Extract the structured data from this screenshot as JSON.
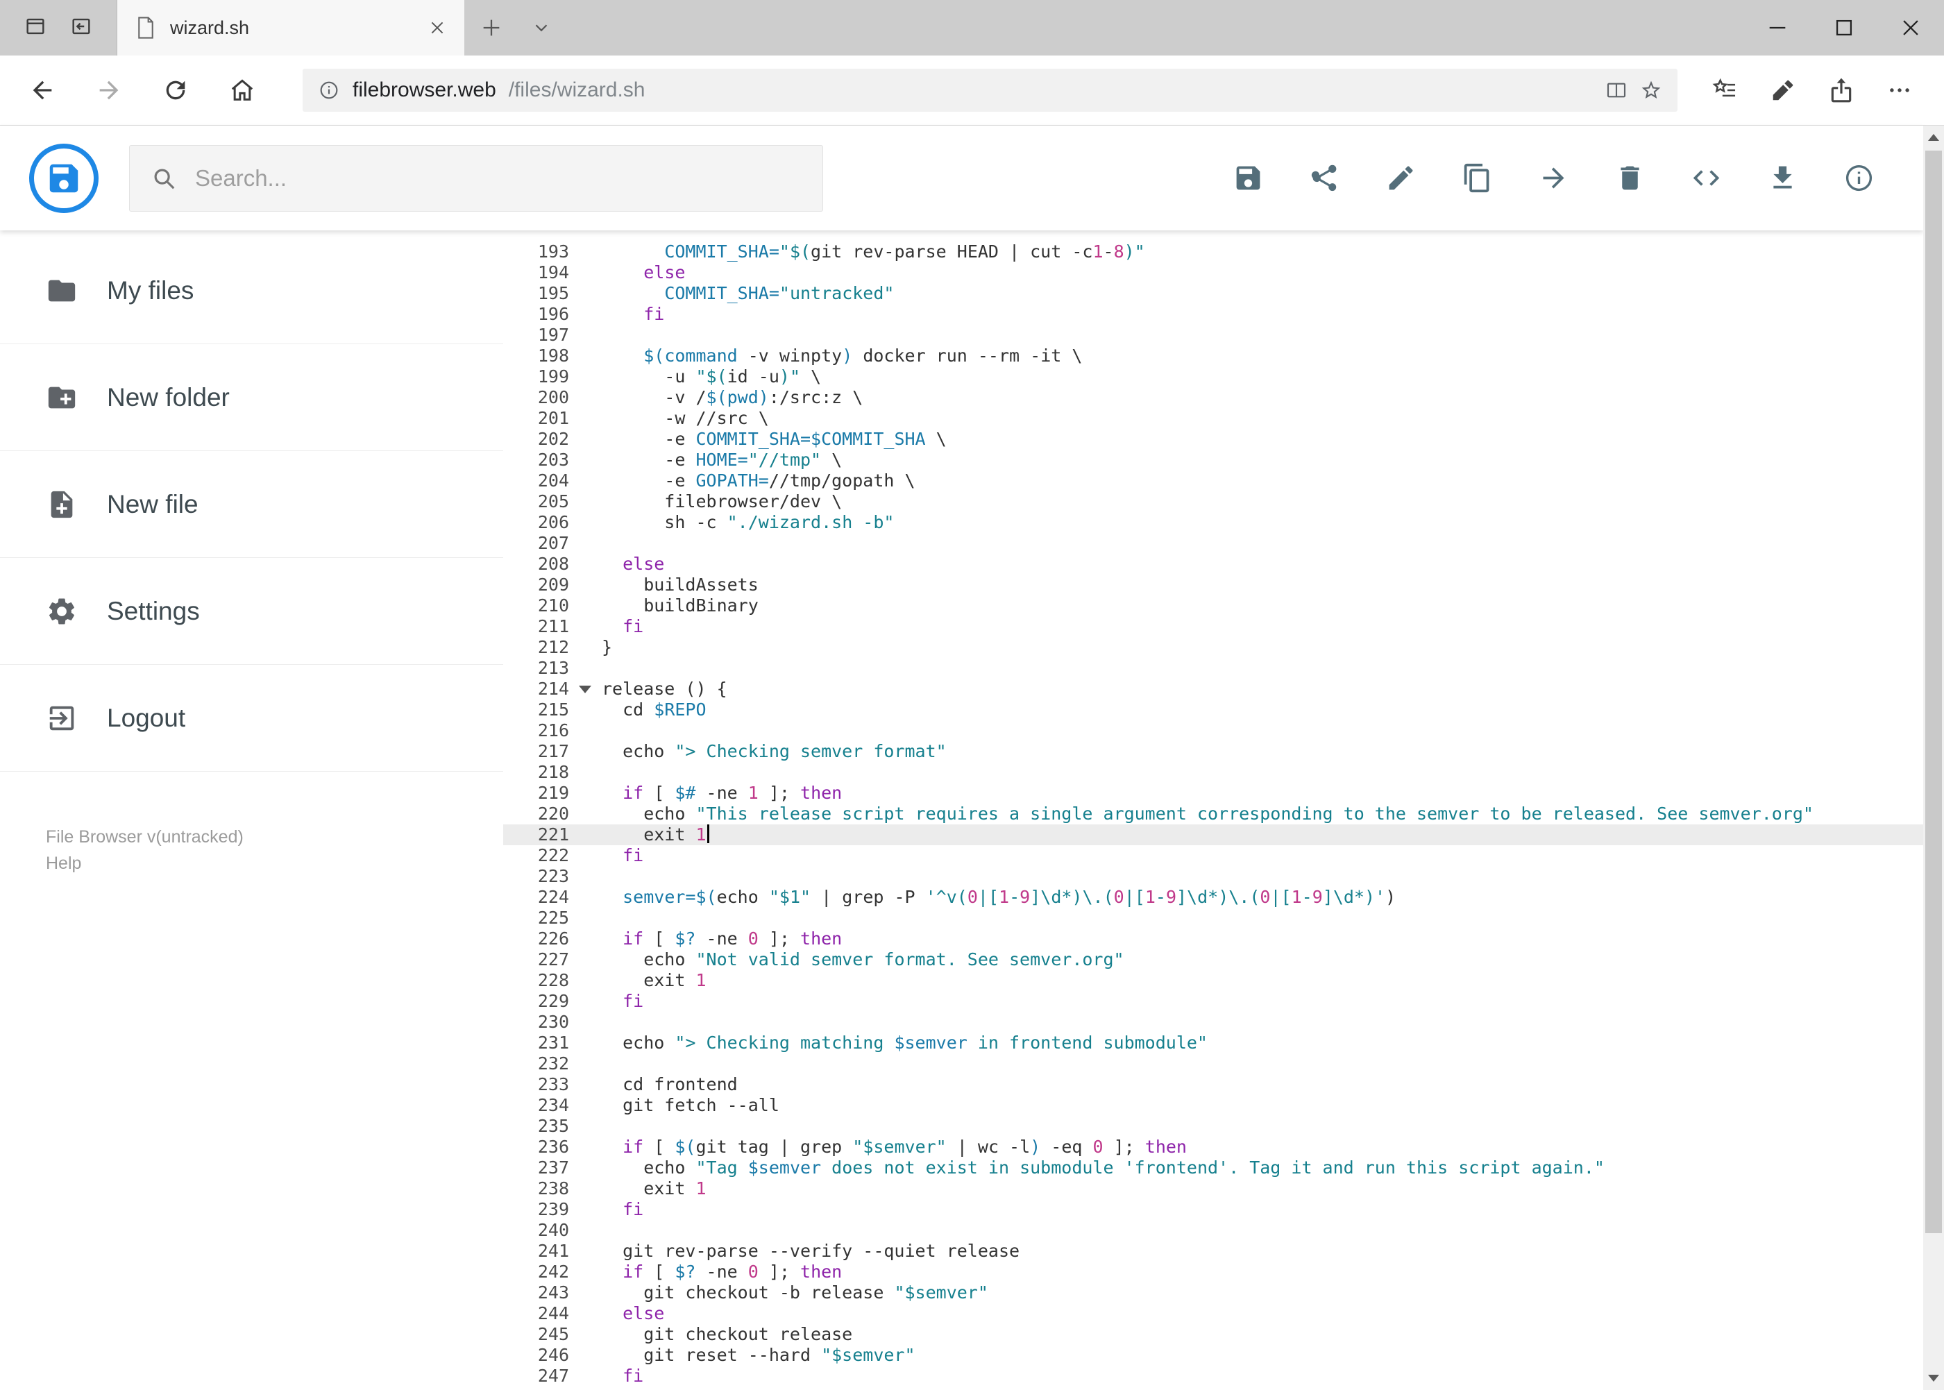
{
  "browser": {
    "tab": {
      "title": "wizard.sh"
    },
    "address": {
      "host": "filebrowser.web",
      "path": "/files/wizard.sh"
    }
  },
  "header": {
    "accent": "#1e88e5",
    "search_placeholder": "Search...",
    "toolbar_icons": [
      "save",
      "share",
      "rename",
      "copy",
      "move",
      "delete",
      "switch-view",
      "download",
      "info"
    ]
  },
  "sidebar": {
    "items": [
      {
        "label": "My files"
      },
      {
        "label": "New folder"
      },
      {
        "label": "New file"
      },
      {
        "label": "Settings"
      },
      {
        "label": "Logout"
      }
    ],
    "footer": {
      "version": "File Browser v(untracked)",
      "help": "Help"
    }
  },
  "editor": {
    "language": "shell",
    "active_line": 221,
    "fold_line": 214,
    "colors": {
      "plain": "#333333",
      "keyword": "#8e24aa",
      "string": "#16808e",
      "variable": "#1a7aa8",
      "number": "#c0398a"
    },
    "lines": [
      {
        "n": 193,
        "t": [
          [
            "p",
            "      "
          ],
          [
            "v",
            "COMMIT_SHA="
          ],
          [
            "s",
            "\"$("
          ],
          [
            "p",
            "git rev-parse HEAD | cut -c"
          ],
          [
            "n",
            "1"
          ],
          [
            "p",
            "-"
          ],
          [
            "n",
            "8"
          ],
          [
            "s",
            ")\""
          ]
        ]
      },
      {
        "n": 194,
        "t": [
          [
            "p",
            "    "
          ],
          [
            "k",
            "else"
          ]
        ]
      },
      {
        "n": 195,
        "t": [
          [
            "p",
            "      "
          ],
          [
            "v",
            "COMMIT_SHA="
          ],
          [
            "s",
            "\"untracked\""
          ]
        ]
      },
      {
        "n": 196,
        "t": [
          [
            "p",
            "    "
          ],
          [
            "k",
            "fi"
          ]
        ]
      },
      {
        "n": 197,
        "t": []
      },
      {
        "n": 198,
        "t": [
          [
            "p",
            "    "
          ],
          [
            "v",
            "$(command"
          ],
          [
            "p",
            " -v winpty"
          ],
          [
            "v",
            ")"
          ],
          [
            "p",
            " docker run --rm -it \\"
          ]
        ]
      },
      {
        "n": 199,
        "t": [
          [
            "p",
            "      -u "
          ],
          [
            "s",
            "\"$("
          ],
          [
            "p",
            "id -u"
          ],
          [
            "s",
            ")\""
          ],
          [
            "p",
            " \\"
          ]
        ]
      },
      {
        "n": 200,
        "t": [
          [
            "p",
            "      -v /"
          ],
          [
            "v",
            "$(pwd)"
          ],
          [
            "p",
            ":/src:z \\"
          ]
        ]
      },
      {
        "n": 201,
        "t": [
          [
            "p",
            "      -w //src \\"
          ]
        ]
      },
      {
        "n": 202,
        "t": [
          [
            "p",
            "      -e "
          ],
          [
            "v",
            "COMMIT_SHA=$COMMIT_SHA"
          ],
          [
            "p",
            " \\"
          ]
        ]
      },
      {
        "n": 203,
        "t": [
          [
            "p",
            "      -e "
          ],
          [
            "v",
            "HOME="
          ],
          [
            "s",
            "\"//tmp\""
          ],
          [
            "p",
            " \\"
          ]
        ]
      },
      {
        "n": 204,
        "t": [
          [
            "p",
            "      -e "
          ],
          [
            "v",
            "GOPATH="
          ],
          [
            "p",
            "//tmp/gopath \\"
          ]
        ]
      },
      {
        "n": 205,
        "t": [
          [
            "p",
            "      filebrowser/dev \\"
          ]
        ]
      },
      {
        "n": 206,
        "t": [
          [
            "p",
            "      sh -c "
          ],
          [
            "s",
            "\"./wizard.sh -b\""
          ]
        ]
      },
      {
        "n": 207,
        "t": []
      },
      {
        "n": 208,
        "t": [
          [
            "p",
            "  "
          ],
          [
            "k",
            "else"
          ]
        ]
      },
      {
        "n": 209,
        "t": [
          [
            "p",
            "    buildAssets"
          ]
        ]
      },
      {
        "n": 210,
        "t": [
          [
            "p",
            "    buildBinary"
          ]
        ]
      },
      {
        "n": 211,
        "t": [
          [
            "p",
            "  "
          ],
          [
            "k",
            "fi"
          ]
        ]
      },
      {
        "n": 212,
        "t": [
          [
            "p",
            "}"
          ]
        ]
      },
      {
        "n": 213,
        "t": []
      },
      {
        "n": 214,
        "t": [
          [
            "p",
            "release () {"
          ]
        ]
      },
      {
        "n": 215,
        "t": [
          [
            "p",
            "  cd "
          ],
          [
            "v",
            "$REPO"
          ]
        ]
      },
      {
        "n": 216,
        "t": []
      },
      {
        "n": 217,
        "t": [
          [
            "p",
            "  echo "
          ],
          [
            "s",
            "\"> Checking semver format\""
          ]
        ]
      },
      {
        "n": 218,
        "t": []
      },
      {
        "n": 219,
        "t": [
          [
            "p",
            "  "
          ],
          [
            "k",
            "if"
          ],
          [
            "p",
            " [ "
          ],
          [
            "v",
            "$#"
          ],
          [
            "p",
            " -ne "
          ],
          [
            "n",
            "1"
          ],
          [
            "p",
            " ]; "
          ],
          [
            "k",
            "then"
          ]
        ]
      },
      {
        "n": 220,
        "t": [
          [
            "p",
            "    echo "
          ],
          [
            "s",
            "\"This release script requires a single argument corresponding to the semver to be released. See semver.org\""
          ]
        ]
      },
      {
        "n": 221,
        "t": [
          [
            "p",
            "    exit "
          ],
          [
            "n",
            "1"
          ]
        ]
      },
      {
        "n": 222,
        "t": [
          [
            "p",
            "  "
          ],
          [
            "k",
            "fi"
          ]
        ]
      },
      {
        "n": 223,
        "t": []
      },
      {
        "n": 224,
        "t": [
          [
            "p",
            "  "
          ],
          [
            "v",
            "semver=$("
          ],
          [
            "p",
            "echo "
          ],
          [
            "s",
            "\"$1\""
          ],
          [
            "p",
            " | grep -P "
          ],
          [
            "s",
            "'^v("
          ],
          [
            "n",
            "0"
          ],
          [
            "s",
            "|["
          ],
          [
            "n",
            "1"
          ],
          [
            "s",
            "-"
          ],
          [
            "n",
            "9"
          ],
          [
            "s",
            "]\\d*)\\.("
          ],
          [
            "n",
            "0"
          ],
          [
            "s",
            "|["
          ],
          [
            "n",
            "1"
          ],
          [
            "s",
            "-"
          ],
          [
            "n",
            "9"
          ],
          [
            "s",
            "]\\d*)\\.("
          ],
          [
            "n",
            "0"
          ],
          [
            "s",
            "|["
          ],
          [
            "n",
            "1"
          ],
          [
            "s",
            "-"
          ],
          [
            "n",
            "9"
          ],
          [
            "s",
            "]\\d*)'"
          ],
          [
            "p",
            ")"
          ]
        ]
      },
      {
        "n": 225,
        "t": []
      },
      {
        "n": 226,
        "t": [
          [
            "p",
            "  "
          ],
          [
            "k",
            "if"
          ],
          [
            "p",
            " [ "
          ],
          [
            "v",
            "$?"
          ],
          [
            "p",
            " -ne "
          ],
          [
            "n",
            "0"
          ],
          [
            "p",
            " ]; "
          ],
          [
            "k",
            "then"
          ]
        ]
      },
      {
        "n": 227,
        "t": [
          [
            "p",
            "    echo "
          ],
          [
            "s",
            "\"Not valid semver format. See semver.org\""
          ]
        ]
      },
      {
        "n": 228,
        "t": [
          [
            "p",
            "    exit "
          ],
          [
            "n",
            "1"
          ]
        ]
      },
      {
        "n": 229,
        "t": [
          [
            "p",
            "  "
          ],
          [
            "k",
            "fi"
          ]
        ]
      },
      {
        "n": 230,
        "t": []
      },
      {
        "n": 231,
        "t": [
          [
            "p",
            "  echo "
          ],
          [
            "s",
            "\"> Checking matching "
          ],
          [
            "v",
            "$semver"
          ],
          [
            "s",
            " in frontend submodule\""
          ]
        ]
      },
      {
        "n": 232,
        "t": []
      },
      {
        "n": 233,
        "t": [
          [
            "p",
            "  cd frontend"
          ]
        ]
      },
      {
        "n": 234,
        "t": [
          [
            "p",
            "  git fetch --all"
          ]
        ]
      },
      {
        "n": 235,
        "t": []
      },
      {
        "n": 236,
        "t": [
          [
            "p",
            "  "
          ],
          [
            "k",
            "if"
          ],
          [
            "p",
            " [ "
          ],
          [
            "v",
            "$("
          ],
          [
            "p",
            "git tag | grep "
          ],
          [
            "s",
            "\"$semver\""
          ],
          [
            "p",
            " | wc -l"
          ],
          [
            "v",
            ")"
          ],
          [
            "p",
            " -eq "
          ],
          [
            "n",
            "0"
          ],
          [
            "p",
            " ]; "
          ],
          [
            "k",
            "then"
          ]
        ]
      },
      {
        "n": 237,
        "t": [
          [
            "p",
            "    echo "
          ],
          [
            "s",
            "\"Tag "
          ],
          [
            "v",
            "$semver"
          ],
          [
            "s",
            " does not exist in submodule 'frontend'. Tag it and run this script again.\""
          ]
        ]
      },
      {
        "n": 238,
        "t": [
          [
            "p",
            "    exit "
          ],
          [
            "n",
            "1"
          ]
        ]
      },
      {
        "n": 239,
        "t": [
          [
            "p",
            "  "
          ],
          [
            "k",
            "fi"
          ]
        ]
      },
      {
        "n": 240,
        "t": []
      },
      {
        "n": 241,
        "t": [
          [
            "p",
            "  git rev-parse --verify --quiet release"
          ]
        ]
      },
      {
        "n": 242,
        "t": [
          [
            "p",
            "  "
          ],
          [
            "k",
            "if"
          ],
          [
            "p",
            " [ "
          ],
          [
            "v",
            "$?"
          ],
          [
            "p",
            " -ne "
          ],
          [
            "n",
            "0"
          ],
          [
            "p",
            " ]; "
          ],
          [
            "k",
            "then"
          ]
        ]
      },
      {
        "n": 243,
        "t": [
          [
            "p",
            "    git checkout -b release "
          ],
          [
            "s",
            "\"$semver\""
          ]
        ]
      },
      {
        "n": 244,
        "t": [
          [
            "p",
            "  "
          ],
          [
            "k",
            "else"
          ]
        ]
      },
      {
        "n": 245,
        "t": [
          [
            "p",
            "    git checkout release"
          ]
        ]
      },
      {
        "n": 246,
        "t": [
          [
            "p",
            "    git reset --hard "
          ],
          [
            "s",
            "\"$semver\""
          ]
        ]
      },
      {
        "n": 247,
        "t": [
          [
            "p",
            "  "
          ],
          [
            "k",
            "fi"
          ]
        ]
      }
    ]
  }
}
